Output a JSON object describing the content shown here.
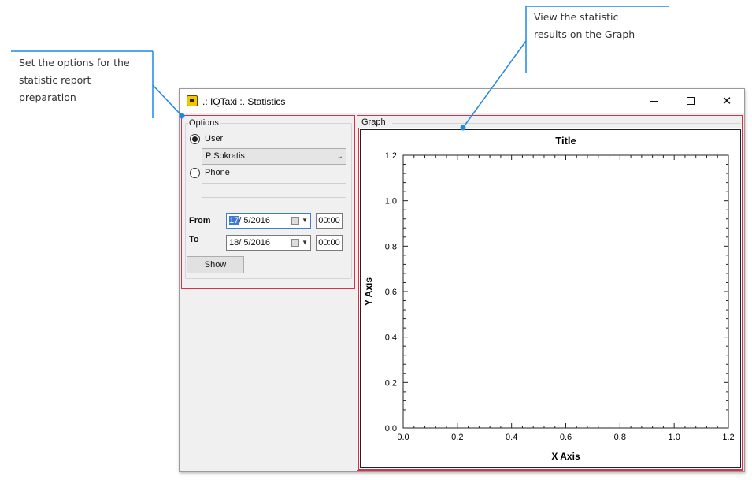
{
  "callouts": {
    "left": [
      "Set the options for the",
      "statistic report",
      "preparation"
    ],
    "right": [
      "View the statistic",
      "results on the Graph"
    ]
  },
  "window": {
    "title": ".: IQTaxi :.  Statistics"
  },
  "options": {
    "group_label": "Options",
    "user_radio_label": "User",
    "user_selected": "P Sokratis",
    "phone_radio_label": "Phone",
    "phone_value": "",
    "from_label": "From",
    "from_date_day": "17",
    "from_date_rest": "/  5/2016",
    "from_time": "00:00",
    "to_label": "To",
    "to_date": "18/  5/2016",
    "to_time": "00:00",
    "show_button": "Show"
  },
  "graph": {
    "panel_label": "Graph"
  },
  "chart_data": {
    "type": "line",
    "title": "Title",
    "xlabel": "X Axis",
    "ylabel": "Y Axis",
    "xlim": [
      0,
      1.2
    ],
    "ylim": [
      0,
      1.2
    ],
    "x_ticks": [
      "0.0",
      "0.2",
      "0.4",
      "0.6",
      "0.8",
      "1.0",
      "1.2"
    ],
    "y_ticks": [
      "0.0",
      "0.2",
      "0.4",
      "0.6",
      "0.8",
      "1.0",
      "1.2"
    ],
    "grid": false,
    "series": []
  }
}
